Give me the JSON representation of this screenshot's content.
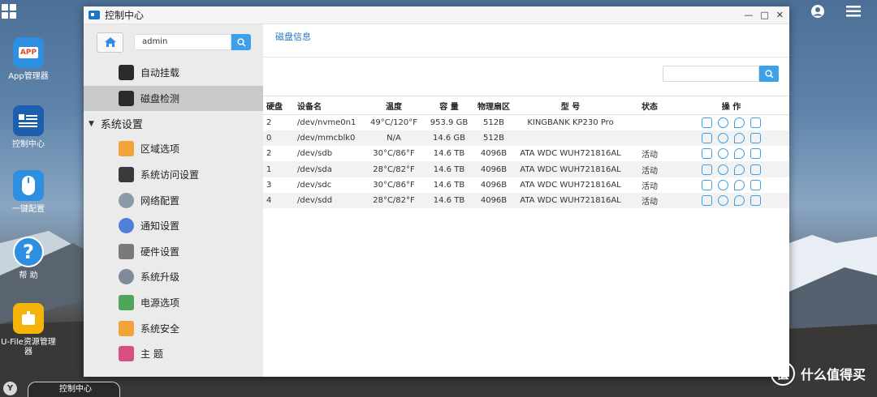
{
  "desktop": {
    "icons": [
      {
        "label": "App管理器",
        "glyph": "APP",
        "color": "#2e8fe0"
      },
      {
        "label": "控制中心",
        "glyph": "",
        "color": "#1b5fae"
      },
      {
        "label": "一键配置",
        "glyph": "",
        "color": "#2e8fe0"
      },
      {
        "label": "帮 助",
        "glyph": "?",
        "color": "#2e8fe0"
      },
      {
        "label": "U-File资源管理器",
        "glyph": "",
        "color": "#f5b40a"
      }
    ]
  },
  "window": {
    "title": "控制中心",
    "controls": {
      "minimize": "—",
      "maximize": "□",
      "close": "✕"
    }
  },
  "sidebar": {
    "search_value": "admin",
    "items_top": [
      {
        "label": "自动挂载",
        "icon": "auto-mount-icon",
        "color": "#2b2b2b"
      },
      {
        "label": "磁盘检测",
        "icon": "disk-check-icon",
        "color": "#2b2b2b"
      }
    ],
    "group_label": "系统设置",
    "group_items": [
      {
        "label": "区域选项",
        "icon": "region-icon",
        "color": "#f2a33a"
      },
      {
        "label": "系统访问设置",
        "icon": "access-icon",
        "color": "#3a3a3a"
      },
      {
        "label": "网络配置",
        "icon": "network-icon",
        "color": "#8a9aa8"
      },
      {
        "label": "通知设置",
        "icon": "notification-icon",
        "color": "#4f7fd8"
      },
      {
        "label": "硬件设置",
        "icon": "hardware-icon",
        "color": "#7a7a7a"
      },
      {
        "label": "系统升级",
        "icon": "upgrade-icon",
        "color": "#7e8c99"
      },
      {
        "label": "电源选项",
        "icon": "power-icon",
        "color": "#4fa65a"
      },
      {
        "label": "系统安全",
        "icon": "security-icon",
        "color": "#f2a33a"
      },
      {
        "label": "主 题",
        "icon": "theme-icon",
        "color": "#d94f84"
      }
    ]
  },
  "main": {
    "title": "磁盘信息",
    "table": {
      "headers": [
        "硬盘",
        "设备名",
        "温度",
        "容 量",
        "物理扇区",
        "型 号",
        "状态",
        "操 作"
      ],
      "rows": [
        [
          "2",
          "/dev/nvme0n1",
          "49°C/120°F",
          "953.9 GB",
          "512B",
          "KINGBANK KP230 Pro",
          ""
        ],
        [
          "0",
          "/dev/mmcblk0",
          "N/A",
          "14.6 GB",
          "512B",
          "",
          ""
        ],
        [
          "2",
          "/dev/sdb",
          "30°C/86°F",
          "14.6 TB",
          "4096B",
          "ATA WDC WUH721816AL",
          "活动"
        ],
        [
          "1",
          "/dev/sda",
          "28°C/82°F",
          "14.6 TB",
          "4096B",
          "ATA WDC WUH721816AL",
          "活动"
        ],
        [
          "3",
          "/dev/sdc",
          "30°C/86°F",
          "14.6 TB",
          "4096B",
          "ATA WDC WUH721816AL",
          "活动"
        ],
        [
          "4",
          "/dev/sdd",
          "28°C/82°F",
          "14.6 TB",
          "4096B",
          "ATA WDC WUH721816AL",
          "活动"
        ]
      ]
    }
  },
  "taskbar": {
    "task_label": "控制中心",
    "logo": "Y"
  },
  "watermark": {
    "logo": "值",
    "text": "什么值得买"
  },
  "colors": {
    "accent": "#3da0e8",
    "link": "#2676c8"
  }
}
